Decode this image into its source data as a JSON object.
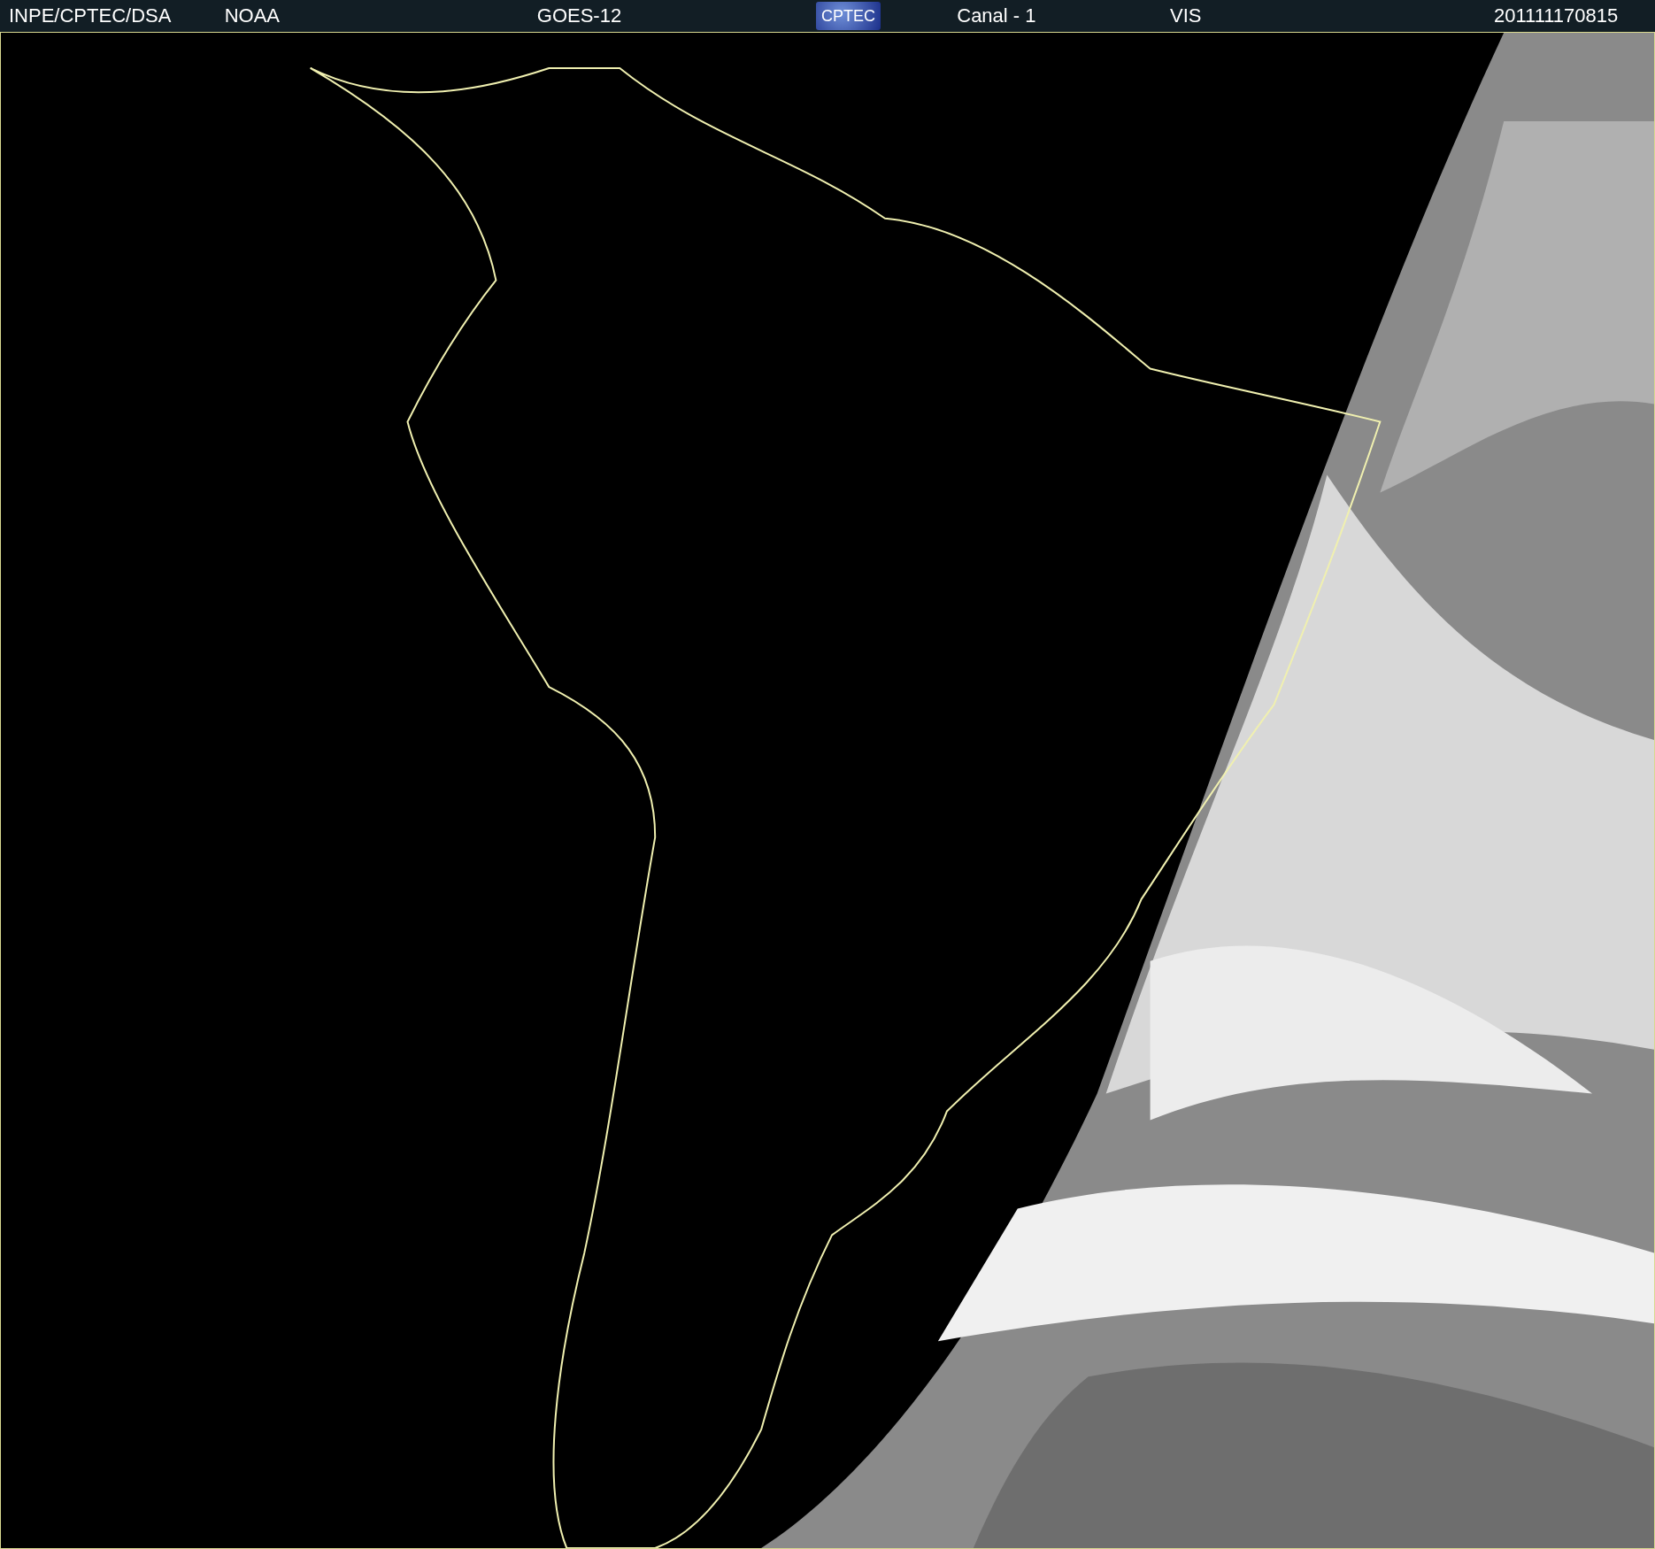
{
  "header": {
    "items": [
      {
        "kind": "text",
        "text": "INPE/CPTEC/DSA"
      },
      {
        "kind": "text",
        "text": "NOAA"
      },
      {
        "kind": "text",
        "text": "GOES-12"
      },
      {
        "kind": "logo",
        "text": "CPTEC"
      },
      {
        "kind": "text",
        "text": "Canal - 1"
      },
      {
        "kind": "text",
        "text": "VIS"
      },
      {
        "kind": "text",
        "text": "201111170815"
      }
    ]
  }
}
